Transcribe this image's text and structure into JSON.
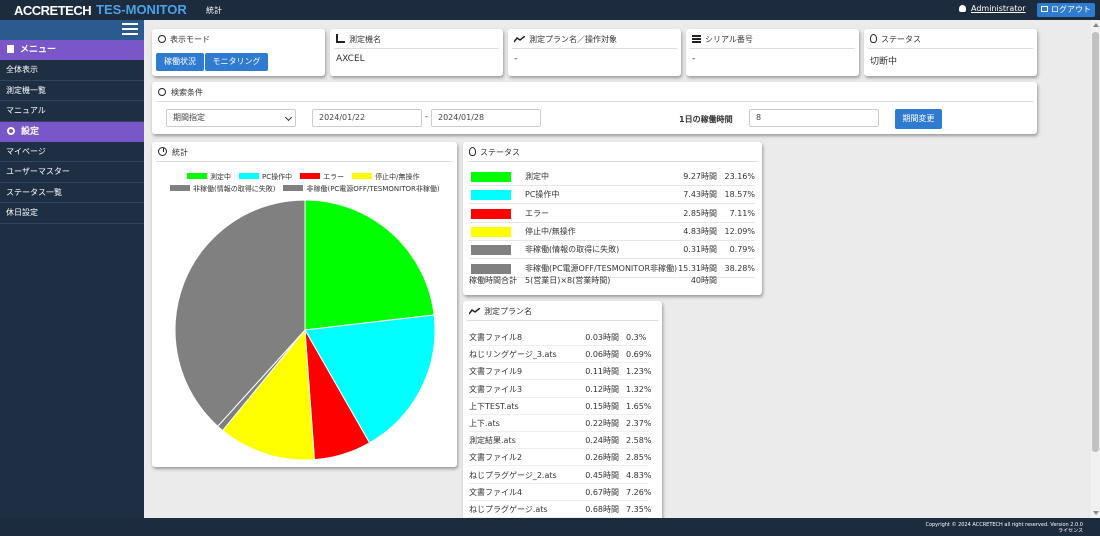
{
  "header": {
    "logo": "ACCRETECH",
    "app_name": "TES-MONITOR",
    "page": "統計",
    "user": "Administrator",
    "logout": "ログアウト"
  },
  "sidebar": {
    "menu_label": "メニュー",
    "menu_items": [
      {
        "label": "全体表示"
      },
      {
        "label": "測定機一覧"
      },
      {
        "label": "マニュアル"
      }
    ],
    "settings_label": "設定",
    "settings_items": [
      {
        "label": "マイページ"
      },
      {
        "label": "ユーザーマスター"
      },
      {
        "label": "ステータス一覧"
      },
      {
        "label": "休日設定"
      }
    ]
  },
  "info": {
    "display_mode_title": "表示モード",
    "btn_operation": "稼働状況",
    "btn_monitoring": "モニタリング",
    "machine_title": "測定機名",
    "machine_value": "AXCEL",
    "plan_title": "測定プラン名／操作対象",
    "plan_value": "-",
    "serial_title": "シリアル番号",
    "serial_value": "-",
    "status_title": "ステータス",
    "status_value": "切断中"
  },
  "search": {
    "title": "検索条件",
    "period_select": "期間指定",
    "date_from": "2024/01/22",
    "separator": "-",
    "date_to": "2024/01/28",
    "hours_label": "1日の稼働時間",
    "hours_value": "8",
    "change_button": "期間変更"
  },
  "stats": {
    "title": "統計"
  },
  "status_table": {
    "title": "ステータス",
    "rows": [
      {
        "label": "測定中",
        "hours": "9.27時間",
        "pct": "23.16%",
        "color": "#00ff00"
      },
      {
        "label": "PC操作中",
        "hours": "7.43時間",
        "pct": "18.57%",
        "color": "#00ffff"
      },
      {
        "label": "エラー",
        "hours": "2.85時間",
        "pct": "7.11%",
        "color": "#ff0000"
      },
      {
        "label": "停止中/無操作",
        "hours": "4.83時間",
        "pct": "12.09%",
        "color": "#ffff00"
      },
      {
        "label": "非稼働(情報の取得に失敗)",
        "hours": "0.31時間",
        "pct": "0.79%",
        "color": "#808080"
      },
      {
        "label": "非稼働(PC電源OFF/TESMONITOR非稼働)",
        "hours": "15.31時間",
        "pct": "38.28%",
        "color": "#808080"
      }
    ],
    "total_label": "稼働時間合計　5(営業日)×8(営業時間)",
    "total_hours": "40時間"
  },
  "plan_table": {
    "title": "測定プラン名",
    "rows": [
      {
        "label": "文書ファイル8",
        "hours": "0.03時間",
        "pct": "0.3%"
      },
      {
        "label": "ねじリングゲージ_3.ats",
        "hours": "0.06時間",
        "pct": "0.69%"
      },
      {
        "label": "文書ファイル9",
        "hours": "0.11時間",
        "pct": "1.23%"
      },
      {
        "label": "文書ファイル3",
        "hours": "0.12時間",
        "pct": "1.32%"
      },
      {
        "label": "上下TEST.ats",
        "hours": "0.15時間",
        "pct": "1.65%"
      },
      {
        "label": "上下.ats",
        "hours": "0.22時間",
        "pct": "2.37%"
      },
      {
        "label": "測定結果.ats",
        "hours": "0.24時間",
        "pct": "2.58%"
      },
      {
        "label": "文書ファイル2",
        "hours": "0.26時間",
        "pct": "2.85%"
      },
      {
        "label": "ねじプラグゲージ_2.ats",
        "hours": "0.45時間",
        "pct": "4.83%"
      },
      {
        "label": "文書ファイル4",
        "hours": "0.67時間",
        "pct": "7.26%"
      },
      {
        "label": "ねじプラグゲージ.ats",
        "hours": "0.68時間",
        "pct": "7.35%"
      }
    ]
  },
  "chart_data": {
    "type": "pie",
    "title": "",
    "categories": [
      "測定中",
      "PC操作中",
      "エラー",
      "停止中/無操作",
      "非稼働(情報の取得に失敗)",
      "非稼働(PC電源OFF/TESMONITOR非稼働)"
    ],
    "values": [
      23.16,
      18.57,
      7.11,
      12.09,
      0.79,
      38.28
    ],
    "colors": [
      "#00ff00",
      "#00ffff",
      "#ff0000",
      "#ffff00",
      "#808080",
      "#808080"
    ],
    "legend_position": "top"
  },
  "footer": {
    "copyright": "Copyright © 2024 ACCRETECH all right reserved. Version 2.0.0",
    "license": "ライセンス"
  }
}
